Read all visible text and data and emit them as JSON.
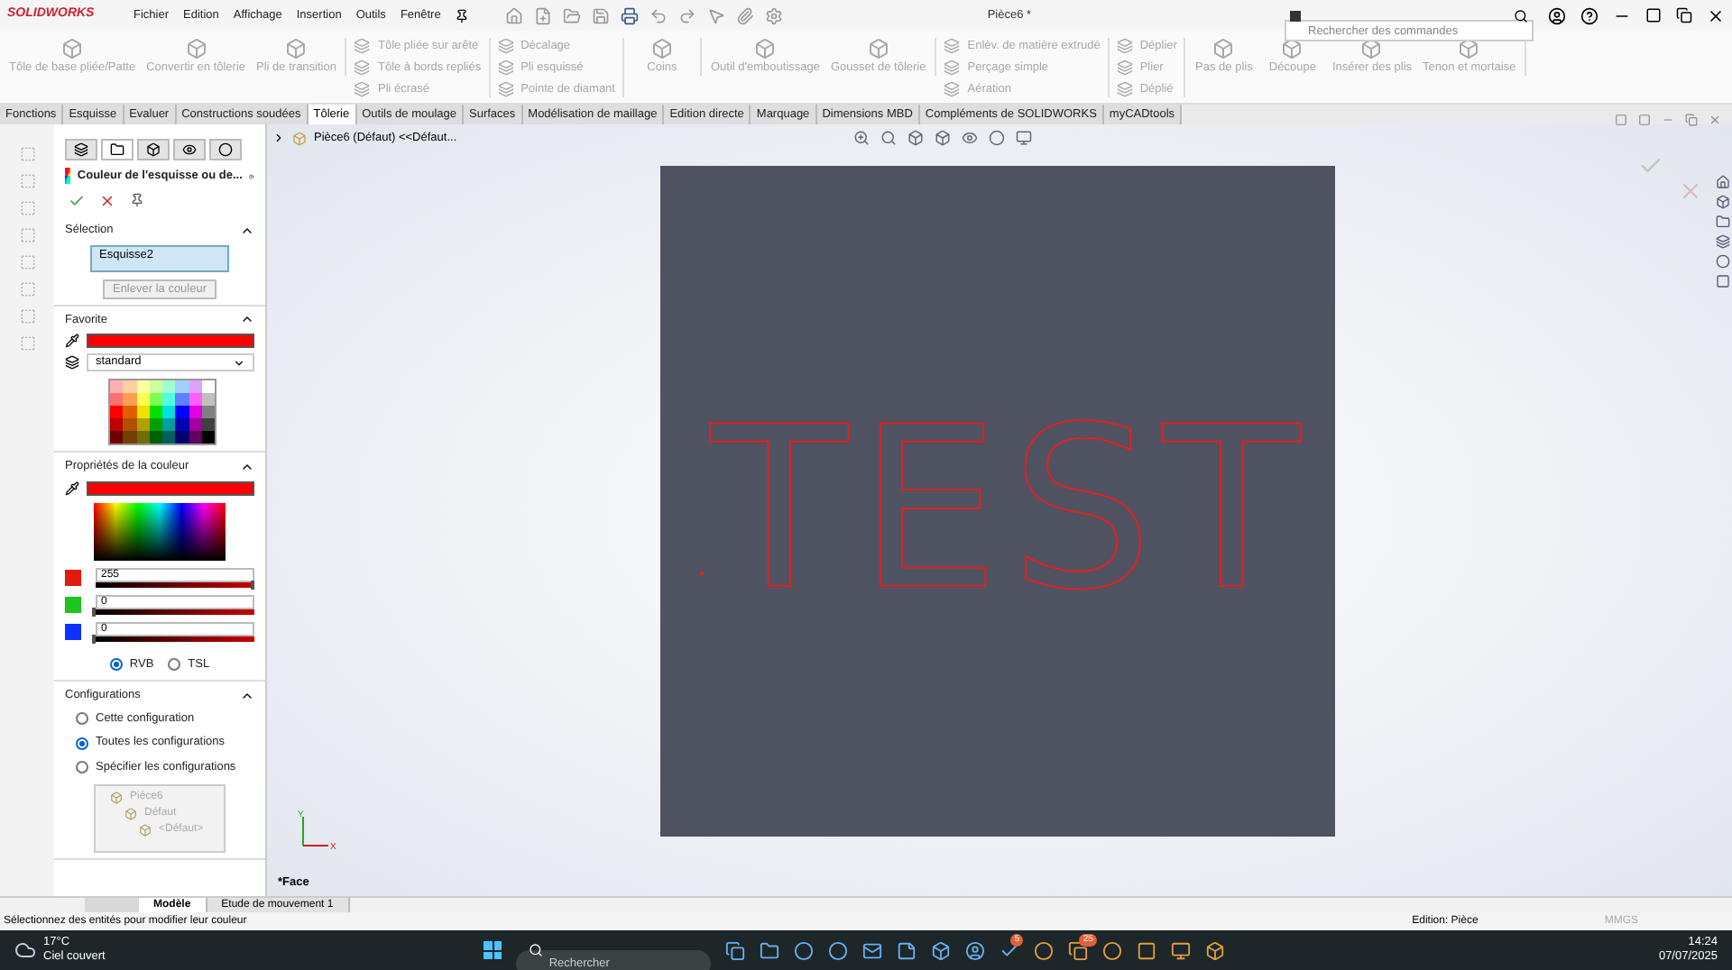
{
  "app": {
    "logo": "SOLIDWORKS",
    "menus": [
      "Fichier",
      "Edition",
      "Affichage",
      "Insertion",
      "Outils",
      "Fenêtre"
    ],
    "doc_title": "Pièce6 *",
    "command_search": {
      "placeholder": "Rechercher des commandes"
    }
  },
  "ribbon": {
    "groups": [
      {
        "kind": "large",
        "disabled": true,
        "items": [
          "Tôle de base pliée/Patte",
          "Convertir en tôlerie",
          "Pli de transition"
        ]
      },
      {
        "kind": "stack",
        "disabled": true,
        "items": [
          "Tôle pliée sur arête",
          "Tôle à bords repliés",
          "Pli écrasé"
        ]
      },
      {
        "kind": "stack",
        "disabled": true,
        "items": [
          "Décalage",
          "Pli esquissé",
          "Pointe de diamant"
        ]
      },
      {
        "kind": "large",
        "disabled": true,
        "items": [
          "Coins"
        ]
      },
      {
        "kind": "large",
        "disabled": true,
        "items": [
          "Outil d'emboutissage",
          "Gousset de tôlerie"
        ]
      },
      {
        "kind": "stack",
        "disabled": true,
        "items": [
          "Enlèv. de matière extrudé",
          "Perçage simple",
          "Aération"
        ]
      },
      {
        "kind": "stack",
        "disabled": true,
        "items": [
          "Déplier",
          "Plier",
          "Déplié"
        ]
      },
      {
        "kind": "large",
        "disabled": true,
        "items": [
          "Pas de plis",
          "Découpe",
          "Insérer des plis",
          "Tenon et mortaise"
        ]
      }
    ]
  },
  "tabs": [
    {
      "label": "Fonctions",
      "selected": false
    },
    {
      "label": "Esquisse",
      "selected": false
    },
    {
      "label": "Evaluer",
      "selected": false
    },
    {
      "label": "Constructions soudées",
      "selected": false
    },
    {
      "label": "Tôlerie",
      "selected": true
    },
    {
      "label": "Outils de moulage",
      "selected": false
    },
    {
      "label": "Surfaces",
      "selected": false
    },
    {
      "label": "Modélisation de maillage",
      "selected": false
    },
    {
      "label": "Edition directe",
      "selected": false
    },
    {
      "label": "Marquage",
      "selected": false
    },
    {
      "label": "Dimensions MBD",
      "selected": false
    },
    {
      "label": "Compléments de SOLIDWORKS",
      "selected": false
    },
    {
      "label": "myCADtools",
      "selected": false
    }
  ],
  "breadcrumb": "Pièce6 (Défaut) <<Défaut...",
  "property_manager": {
    "panel_tabs": [
      {
        "selected": false
      },
      {
        "selected": true
      },
      {
        "selected": false
      },
      {
        "selected": false
      },
      {
        "selected": false
      }
    ],
    "title": "Couleur de l'esquisse ou de...",
    "selection": {
      "heading": "Sélection",
      "item": "Esquisse2",
      "remove_button": "Enlever la couleur"
    },
    "favorite": {
      "heading": "Favorite",
      "color": "#ff0000",
      "dropdown": "standard"
    },
    "color_properties": {
      "heading": "Propriétés de la couleur",
      "color": "#ff0000",
      "channels": [
        {
          "value": "255",
          "level": 1,
          "color": "#e21b0c"
        },
        {
          "value": "0",
          "level": 0,
          "color": "#1ec51e"
        },
        {
          "value": "0",
          "level": 0,
          "color": "#1030ff"
        }
      ],
      "modes": [
        {
          "label": "RVB",
          "selected": true
        },
        {
          "label": "TSL",
          "selected": false
        }
      ]
    },
    "configurations": {
      "heading": "Configurations",
      "options": [
        {
          "label": "Cette configuration",
          "selected": false
        },
        {
          "label": "Toutes les configurations",
          "selected": true
        },
        {
          "label": "Spécifier les configurations",
          "selected": false
        }
      ],
      "tree": [
        {
          "label": "Pièce6",
          "children": [
            {
              "label": "Défaut",
              "children": [
                {
                  "label": "<Défaut>"
                }
              ]
            }
          ]
        }
      ]
    }
  },
  "viewport": {
    "sketch_text": "TEST",
    "view_label": "*Face",
    "triad": [
      "X",
      "Y"
    ]
  },
  "bottom_tabs": [
    {
      "label": "Modèle",
      "selected": true
    },
    {
      "label": "Etude de mouvement 1",
      "selected": false
    }
  ],
  "status_bar": {
    "message": "Sélectionnez des entités pour modifier leur couleur",
    "mode": "Edition: Pièce",
    "units": "MMGS"
  },
  "taskbar": {
    "temperature": "17°C",
    "weather": "Ciel couvert",
    "search": {
      "placeholder": "Rechercher"
    },
    "badges": [
      "5",
      "25"
    ],
    "time": "14:24",
    "date": "07/07/2025"
  }
}
